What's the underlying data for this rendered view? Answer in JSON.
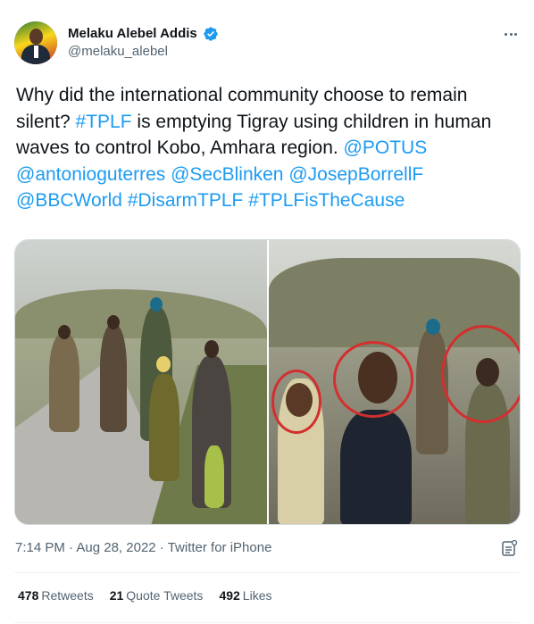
{
  "author": {
    "display_name": "Melaku Alebel Addis",
    "handle": "@melaku_alebel",
    "verified": true,
    "avatar_icon": "user-avatar"
  },
  "tweet": {
    "segments": [
      {
        "text": "Why did the international community choose to remain silent? ",
        "type": "text"
      },
      {
        "text": "#TPLF",
        "type": "link"
      },
      {
        "text": " is emptying Tigray using children in human waves to control Kobo, Amhara region. ",
        "type": "text"
      },
      {
        "text": "@POTUS",
        "type": "link"
      },
      {
        "text": " ",
        "type": "text"
      },
      {
        "text": "@antonioguterres",
        "type": "link"
      },
      {
        "text": " ",
        "type": "text"
      },
      {
        "text": "@SecBlinken",
        "type": "link"
      },
      {
        "text": " ",
        "type": "text"
      },
      {
        "text": "@JosepBorrellF",
        "type": "link"
      },
      {
        "text": " ",
        "type": "text"
      },
      {
        "text": "@BBCWorld",
        "type": "link"
      },
      {
        "text": "  ",
        "type": "text"
      },
      {
        "text": "#DisarmTPLF",
        "type": "link"
      },
      {
        "text": " ",
        "type": "text"
      },
      {
        "text": "#TPLFisTheCause",
        "type": "link"
      }
    ]
  },
  "media": {
    "left_photo": "people walking on a road carrying rifles",
    "right_photo": "people walking with three faces circled in red"
  },
  "meta": {
    "time": "7:14 PM",
    "separator": " · ",
    "date": "Aug 28, 2022",
    "source": "Twitter for iPhone"
  },
  "stats": {
    "retweets_count": "478",
    "retweets_label": "Retweets",
    "quotes_count": "21",
    "quotes_label": "Quote Tweets",
    "likes_count": "492",
    "likes_label": "Likes"
  },
  "colors": {
    "link": "#1d9bf0",
    "secondary_text": "#536471",
    "primary_text": "#0f1419",
    "highlight_circle": "#d32f2f"
  },
  "icons": [
    "verified-badge-icon",
    "more-options-icon",
    "analytics-icon"
  ]
}
